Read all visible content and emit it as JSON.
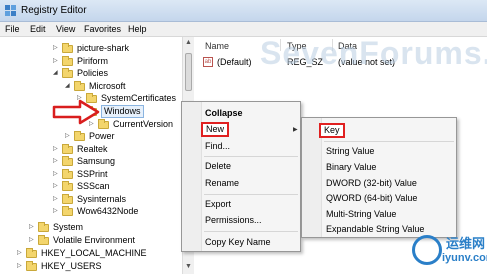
{
  "window": {
    "title": "Registry Editor"
  },
  "menubar": [
    "File",
    "Edit",
    "View",
    "Favorites",
    "Help"
  ],
  "tree": {
    "items": [
      {
        "label": "picture-shark",
        "expander": "▷"
      },
      {
        "label": "Piriform",
        "expander": "▷"
      },
      {
        "label": "Policies",
        "expander": "◢"
      },
      {
        "label": "Microsoft",
        "expander": "◢"
      },
      {
        "label": "SystemCertificates",
        "expander": "▷"
      },
      {
        "label": "Windows",
        "expander": "◢"
      },
      {
        "label": "CurrentVersion",
        "expander": "▷"
      },
      {
        "label": "Power",
        "expander": "▷"
      },
      {
        "label": "Realtek",
        "expander": "▷"
      },
      {
        "label": "Samsung",
        "expander": "▷"
      },
      {
        "label": "SSPrint",
        "expander": "▷"
      },
      {
        "label": "SSScan",
        "expander": "▷"
      },
      {
        "label": "Sysinternals",
        "expander": "▷"
      },
      {
        "label": "Wow6432Node",
        "expander": "▷"
      },
      {
        "label": "System",
        "expander": "▷"
      },
      {
        "label": "Volatile Environment",
        "expander": "▷"
      },
      {
        "label": "HKEY_LOCAL_MACHINE",
        "expander": "▷"
      },
      {
        "label": "HKEY_USERS",
        "expander": "▷"
      }
    ]
  },
  "list": {
    "columns": [
      "Name",
      "Type",
      "Data"
    ],
    "rows": [
      {
        "name": "(Default)",
        "type": "REG_SZ",
        "data": "(value not set)"
      }
    ]
  },
  "watermark": "SevenForums.",
  "context_menu": {
    "items": [
      "Collapse",
      "New",
      "Find...",
      "Delete",
      "Rename",
      "Export",
      "Permissions...",
      "Copy Key Name"
    ]
  },
  "submenu": {
    "items": [
      "Key",
      "String Value",
      "Binary Value",
      "DWORD (32-bit) Value",
      "QWORD (64-bit) Value",
      "Multi-String Value",
      "Expandable String Value"
    ]
  },
  "logo": {
    "line1": "运维网",
    "line2": "iyunv.com"
  },
  "colors": {
    "highlight": "#e02020",
    "folder": "#f3d56c",
    "logo": "#2a7fc8"
  },
  "icons": {
    "app": "registry-icon",
    "value": "string-value-icon",
    "pointer": "red-arrow-icon"
  }
}
